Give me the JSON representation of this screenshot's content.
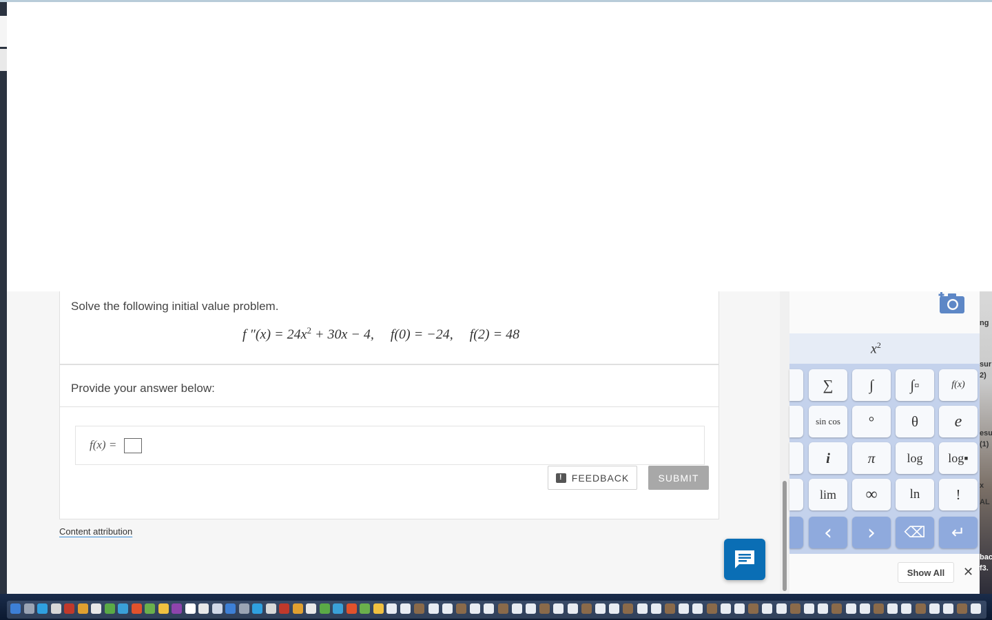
{
  "question": {
    "prompt": "Solve the following initial value problem.",
    "equation_lhs": "f ″(x) = 24x",
    "equation_exp": "2",
    "equation_rest": " + 30x − 4,",
    "condition_1": "f(0) = −24,",
    "condition_2": "f(2) = 48"
  },
  "answer": {
    "prompt": "Provide your answer below:",
    "field_label": "f(x) ="
  },
  "buttons": {
    "feedback": "FEEDBACK",
    "submit": "SUBMIT"
  },
  "footer": {
    "attribution": "Content attribution"
  },
  "keyboard": {
    "tab_x2_base": "x",
    "tab_x2_exp": "2",
    "rows": [
      [
        "∑",
        "∫",
        "∫▫",
        "f(x)"
      ],
      [
        "sin cos",
        "°",
        "θ",
        "e"
      ],
      [
        "i",
        "π",
        "log",
        "log▪"
      ],
      [
        "lim",
        "∞",
        "ln",
        "!"
      ]
    ],
    "nav_keys": [
      "‹",
      "›",
      "⌫",
      "↵"
    ],
    "show_all": "Show All",
    "close": "✕"
  },
  "side_text": [
    "ng",
    "sur",
    "2)",
    "esu",
    "(1)",
    "x",
    "AL",
    "bac",
    "f3."
  ],
  "colors": {
    "accent_blue": "#0a6eb5",
    "keyboard_bg": "#c4d2ec",
    "nav_key": "#8faadd",
    "submit_disabled": "#a8a8a8"
  }
}
